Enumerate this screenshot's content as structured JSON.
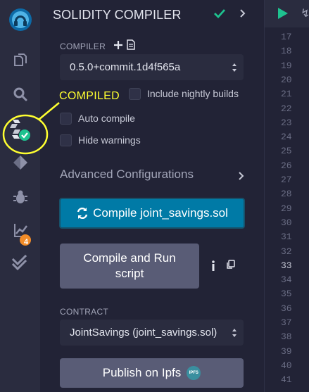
{
  "colors": {
    "accent": "#007aa6",
    "success": "#1ec28f",
    "badge": "#f28c28",
    "annotation": "#ffff30"
  },
  "rail": {
    "icons": [
      "remix-logo-icon",
      "file-explorer-icon",
      "search-icon",
      "solidity-compiler-icon",
      "deploy-run-icon",
      "debugger-icon",
      "analysis-icon",
      "tests-icon"
    ],
    "compiler_status_icon": "success-check-icon",
    "analysis_badge": "4"
  },
  "panel": {
    "title": "SOLIDITY COMPILER",
    "compiler_label": "COMPILER",
    "compiler_version": "0.5.0+commit.1d4f565a",
    "include_nightly_label": "Include nightly builds",
    "auto_compile_label": "Auto compile",
    "hide_warnings_label": "Hide warnings",
    "advanced_label": "Advanced Configurations",
    "compile_button_label": "Compile joint_savings.sol",
    "compile_run_button_label": "Compile and Run script",
    "contract_label": "CONTRACT",
    "contract_value": "JointSavings (joint_savings.sol)",
    "publish_button_label": "Publish on Ipfs",
    "ipfs_badge": "IPFS"
  },
  "annotation": {
    "label": "COMPILED"
  },
  "editor": {
    "run_glyph": "↯",
    "line_numbers": [
      "17",
      "18",
      "19",
      "20",
      "21",
      "22",
      "23",
      "24",
      "25",
      "26",
      "27",
      "28",
      "29",
      "30",
      "31",
      "32",
      "33",
      "34",
      "35",
      "36",
      "37",
      "38",
      "39",
      "40",
      "41"
    ],
    "active_line": "33"
  }
}
